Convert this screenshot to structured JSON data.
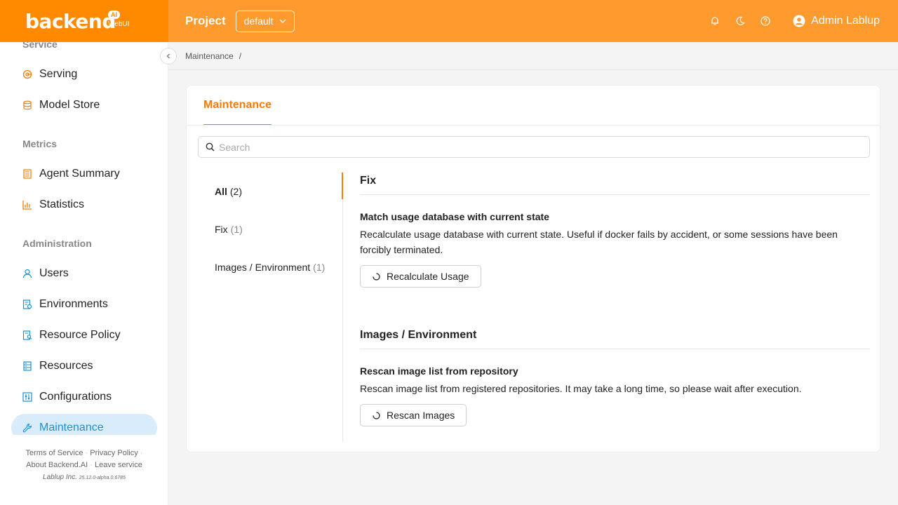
{
  "header": {
    "logo": "backend",
    "logo_badge": "AI",
    "logo_sub": "WebUI",
    "project_label": "Project",
    "project_value": "default",
    "user_name": "Admin Lablup"
  },
  "sidebar": {
    "sections": {
      "service": "Service",
      "metrics": "Metrics",
      "administration": "Administration"
    },
    "items": {
      "serving": "Serving",
      "model_store": "Model Store",
      "agent_summary": "Agent Summary",
      "statistics": "Statistics",
      "users": "Users",
      "environments": "Environments",
      "resource_policy": "Resource Policy",
      "resources": "Resources",
      "configurations": "Configurations",
      "maintenance": "Maintenance"
    },
    "footer": {
      "terms": "Terms of Service",
      "privacy": "Privacy Policy",
      "about": "About Backend.AI",
      "leave": "Leave service",
      "company": "Lablup Inc.",
      "version": "25.12.0-alpha.0.6785"
    }
  },
  "breadcrumb": {
    "current": "Maintenance",
    "separator": "/"
  },
  "card": {
    "tab": "Maintenance",
    "search_placeholder": "Search",
    "filters": [
      {
        "label": "All",
        "count": "(2)"
      },
      {
        "label": "Fix",
        "count": "(1)"
      },
      {
        "label": "Images / Environment",
        "count": "(1)"
      }
    ],
    "groups": [
      {
        "title": "Fix",
        "item_title": "Match usage database with current state",
        "item_desc": "Recalculate usage database with current state. Useful if docker fails by accident, or some sessions have been forcibly terminated.",
        "button": "Recalculate Usage"
      },
      {
        "title": "Images / Environment",
        "item_title": "Rescan image list from repository",
        "item_desc": "Rescan image list from registered repositories. It may take a long time, so please wait after execution.",
        "button": "Rescan Images"
      }
    ]
  },
  "colors": {
    "brand_orange": "#ff8a00",
    "accent_orange": "#ff7a00",
    "active_blue": "#1a8fd8",
    "active_bg": "#d9ecfb"
  }
}
